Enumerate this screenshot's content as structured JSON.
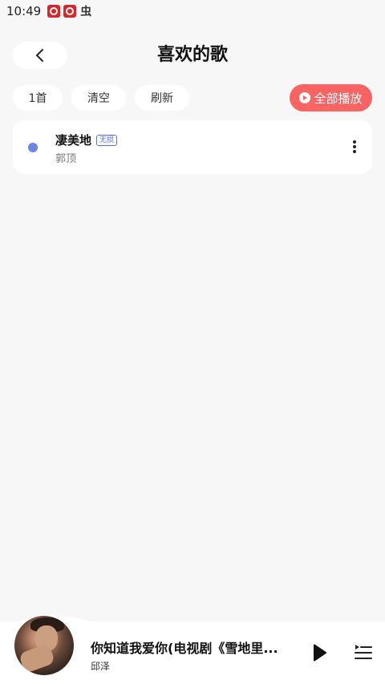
{
  "status_bar": {
    "time": "10:49",
    "icons": [
      "app-notification-icon",
      "app-notification-icon",
      "bug-icon"
    ],
    "third_icon_glyph": "虫"
  },
  "header": {
    "title": "喜欢的歌",
    "back_icon": "chevron-left-icon"
  },
  "toolbar": {
    "count_label": "1首",
    "clear_label": "清空",
    "refresh_label": "刷新",
    "play_all_label": "全部播放",
    "play_all_icon": "play-circle-icon"
  },
  "songs": [
    {
      "title": "凄美地",
      "quality_badge": "无损",
      "artist": "郭顶"
    }
  ],
  "player": {
    "title": "你知道我爱你(电视剧《雪地里...",
    "artist": "邱泽",
    "play_icon": "play-icon",
    "queue_icon": "playlist-icon"
  },
  "colors": {
    "accent": "#fc6363",
    "badge": "#5a6fe0",
    "dot": "#6f86e0",
    "background": "#f7f7f7"
  }
}
